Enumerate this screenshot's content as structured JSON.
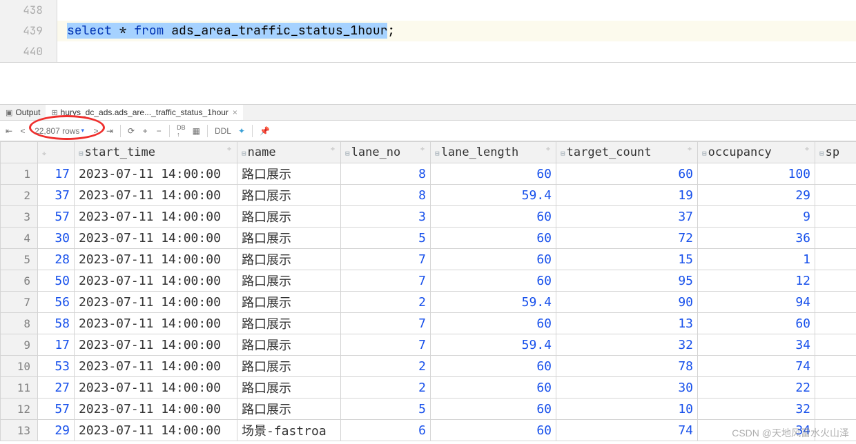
{
  "editor": {
    "lines": [
      {
        "num": "438",
        "content": ""
      },
      {
        "num": "439",
        "content_parts": [
          {
            "t": "select",
            "cls": "kw sel"
          },
          {
            "t": "  * ",
            "cls": "plain sel"
          },
          {
            "t": "from",
            "cls": "kw sel"
          },
          {
            "t": " ads_area_traffic_status_1hour",
            "cls": "plain sel"
          },
          {
            "t": ";",
            "cls": "plain"
          }
        ]
      },
      {
        "num": "440",
        "content": ""
      }
    ]
  },
  "tabs": {
    "output": "Output",
    "result": "hurys_dc_ads.ads_are..._traffic_status_1hour"
  },
  "toolbar": {
    "rows_label": "22,807 rows",
    "ddl_label": "DDL"
  },
  "columns": [
    "",
    "start_time",
    "name",
    "lane_no",
    "lane_length",
    "target_count",
    "occupancy",
    "sp"
  ],
  "rows": [
    {
      "n": 1,
      "id": 17,
      "st": "2023-07-11 14:00:00",
      "nm": "路口展示",
      "ln": 8,
      "ll": "60",
      "tc": 60,
      "oc": 100
    },
    {
      "n": 2,
      "id": 37,
      "st": "2023-07-11 14:00:00",
      "nm": "路口展示",
      "ln": 8,
      "ll": "59.4",
      "tc": 19,
      "oc": 29
    },
    {
      "n": 3,
      "id": 57,
      "st": "2023-07-11 14:00:00",
      "nm": "路口展示",
      "ln": 3,
      "ll": "60",
      "tc": 37,
      "oc": 9
    },
    {
      "n": 4,
      "id": 30,
      "st": "2023-07-11 14:00:00",
      "nm": "路口展示",
      "ln": 5,
      "ll": "60",
      "tc": 72,
      "oc": 36
    },
    {
      "n": 5,
      "id": 28,
      "st": "2023-07-11 14:00:00",
      "nm": "路口展示",
      "ln": 7,
      "ll": "60",
      "tc": 15,
      "oc": 1
    },
    {
      "n": 6,
      "id": 50,
      "st": "2023-07-11 14:00:00",
      "nm": "路口展示",
      "ln": 7,
      "ll": "60",
      "tc": 95,
      "oc": 12
    },
    {
      "n": 7,
      "id": 56,
      "st": "2023-07-11 14:00:00",
      "nm": "路口展示",
      "ln": 2,
      "ll": "59.4",
      "tc": 90,
      "oc": 94
    },
    {
      "n": 8,
      "id": 58,
      "st": "2023-07-11 14:00:00",
      "nm": "路口展示",
      "ln": 7,
      "ll": "60",
      "tc": 13,
      "oc": 60
    },
    {
      "n": 9,
      "id": 17,
      "st": "2023-07-11 14:00:00",
      "nm": "路口展示",
      "ln": 7,
      "ll": "59.4",
      "tc": 32,
      "oc": 34
    },
    {
      "n": 10,
      "id": 53,
      "st": "2023-07-11 14:00:00",
      "nm": "路口展示",
      "ln": 2,
      "ll": "60",
      "tc": 78,
      "oc": 74
    },
    {
      "n": 11,
      "id": 27,
      "st": "2023-07-11 14:00:00",
      "nm": "路口展示",
      "ln": 2,
      "ll": "60",
      "tc": 30,
      "oc": 22
    },
    {
      "n": 12,
      "id": 57,
      "st": "2023-07-11 14:00:00",
      "nm": "路口展示",
      "ln": 5,
      "ll": "60",
      "tc": 10,
      "oc": 32
    },
    {
      "n": 13,
      "id": 29,
      "st": "2023-07-11 14:00:00",
      "nm": "场景-fastroa",
      "ln": 6,
      "ll": "60",
      "tc": 74,
      "oc": 34
    }
  ],
  "watermark": "CSDN @天地风雷水火山泽"
}
